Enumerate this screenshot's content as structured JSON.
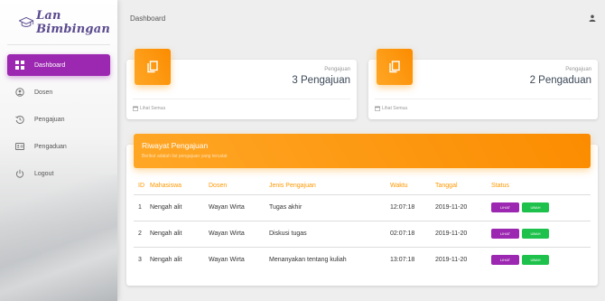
{
  "brand": {
    "name": "Lan Bimbingan"
  },
  "sidebar": {
    "items": [
      {
        "label": "Dashboard",
        "icon": "dashboard-icon",
        "active": true
      },
      {
        "label": "Dosen",
        "icon": "person-circle-icon",
        "active": false
      },
      {
        "label": "Pengajuan",
        "icon": "history-icon",
        "active": false
      },
      {
        "label": "Pengaduan",
        "icon": "id-card-icon",
        "active": false
      },
      {
        "label": "Logout",
        "icon": "power-icon",
        "active": false
      }
    ]
  },
  "topbar": {
    "title": "Dashboard",
    "user_icon": "person-icon"
  },
  "stats": [
    {
      "category": "Pengajuan",
      "value": "3 Pengajuan",
      "footer": "Lihat Semua",
      "icon": "copy-icon"
    },
    {
      "category": "Pengajuan",
      "value": "2 Pengaduan",
      "footer": "Lihat Semua",
      "icon": "copy-icon"
    }
  ],
  "table": {
    "title": "Riwayat Pengajuan",
    "subtitle": "Berikut adalah list pengajuan yang tercatat",
    "headers": [
      "ID",
      "Mahasiswa",
      "Dosen",
      "Jenis Pengajuan",
      "Waktu",
      "Tanggal",
      "Status"
    ],
    "rows": [
      {
        "id": "1",
        "mahasiswa": "Nengah alit",
        "dosen": "Wayan Wirta",
        "jenis": "Tugas akhir",
        "waktu": "12:07:18",
        "tanggal": "2019-11-20"
      },
      {
        "id": "2",
        "mahasiswa": "Nengah alit",
        "dosen": "Wayan Wirta",
        "jenis": "Diskusi tugas",
        "waktu": "02:07:18",
        "tanggal": "2019-11-20"
      },
      {
        "id": "3",
        "mahasiswa": "Nengah alit",
        "dosen": "Wayan Wirta",
        "jenis": "Menanyakan tentang kuliah",
        "waktu": "13:07:18",
        "tanggal": "2019-11-20"
      }
    ],
    "btn_lihat": "LIHAT",
    "btn_ubah": "UBAH"
  },
  "colors": {
    "accent": "#9c27b0",
    "header": "#ff9800",
    "ubah": "#1ec14b"
  }
}
